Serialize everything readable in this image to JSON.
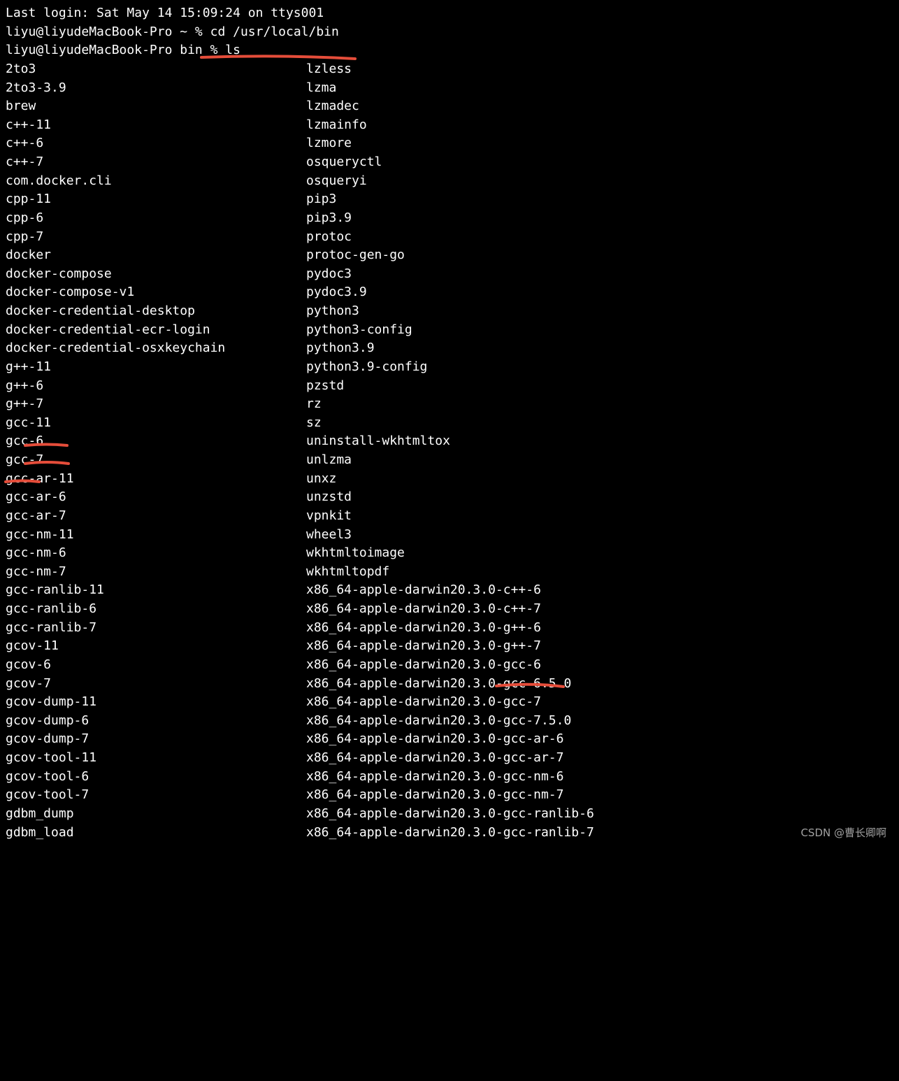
{
  "login_line": "Last login: Sat May 14 15:09:24 on ttys001",
  "prompt1_prefix": "liyu@liyudeMacBook-Pro ~ % ",
  "prompt1_cmd": "cd /usr/local/bin",
  "prompt2_prefix": "liyu@liyudeMacBook-Pro bin % ",
  "prompt2_cmd": "ls",
  "ls_output": {
    "col1": [
      "2to3",
      "2to3-3.9",
      "brew",
      "c++-11",
      "c++-6",
      "c++-7",
      "com.docker.cli",
      "cpp-11",
      "cpp-6",
      "cpp-7",
      "docker",
      "docker-compose",
      "docker-compose-v1",
      "docker-credential-desktop",
      "docker-credential-ecr-login",
      "docker-credential-osxkeychain",
      "g++-11",
      "g++-6",
      "g++-7",
      "gcc-11",
      "gcc-6",
      "gcc-7",
      "gcc-ar-11",
      "gcc-ar-6",
      "gcc-ar-7",
      "gcc-nm-11",
      "gcc-nm-6",
      "gcc-nm-7",
      "gcc-ranlib-11",
      "gcc-ranlib-6",
      "gcc-ranlib-7",
      "gcov-11",
      "gcov-6",
      "gcov-7",
      "gcov-dump-11",
      "gcov-dump-6",
      "gcov-dump-7",
      "gcov-tool-11",
      "gcov-tool-6",
      "gcov-tool-7",
      "gdbm_dump",
      "gdbm_load"
    ],
    "col2": [
      "lzless",
      "lzma",
      "lzmadec",
      "lzmainfo",
      "lzmore",
      "osqueryctl",
      "osqueryi",
      "pip3",
      "pip3.9",
      "protoc",
      "protoc-gen-go",
      "pydoc3",
      "pydoc3.9",
      "python3",
      "python3-config",
      "python3.9",
      "python3.9-config",
      "pzstd",
      "rz",
      "sz",
      "uninstall-wkhtmltox",
      "unlzma",
      "unxz",
      "unzstd",
      "vpnkit",
      "wheel3",
      "wkhtmltoimage",
      "wkhtmltopdf",
      "x86_64-apple-darwin20.3.0-c++-6",
      "x86_64-apple-darwin20.3.0-c++-7",
      "x86_64-apple-darwin20.3.0-g++-6",
      "x86_64-apple-darwin20.3.0-g++-7",
      "x86_64-apple-darwin20.3.0-gcc-6",
      "x86_64-apple-darwin20.3.0-gcc-6.5.0",
      "x86_64-apple-darwin20.3.0-gcc-7",
      "x86_64-apple-darwin20.3.0-gcc-7.5.0",
      "x86_64-apple-darwin20.3.0-gcc-ar-6",
      "x86_64-apple-darwin20.3.0-gcc-ar-7",
      "x86_64-apple-darwin20.3.0-gcc-nm-6",
      "x86_64-apple-darwin20.3.0-gcc-nm-7",
      "x86_64-apple-darwin20.3.0-gcc-ranlib-6",
      "x86_64-apple-darwin20.3.0-gcc-ranlib-7"
    ]
  },
  "watermark": "CSDN @曹长卿啊",
  "underline_color": "#e54d3a"
}
